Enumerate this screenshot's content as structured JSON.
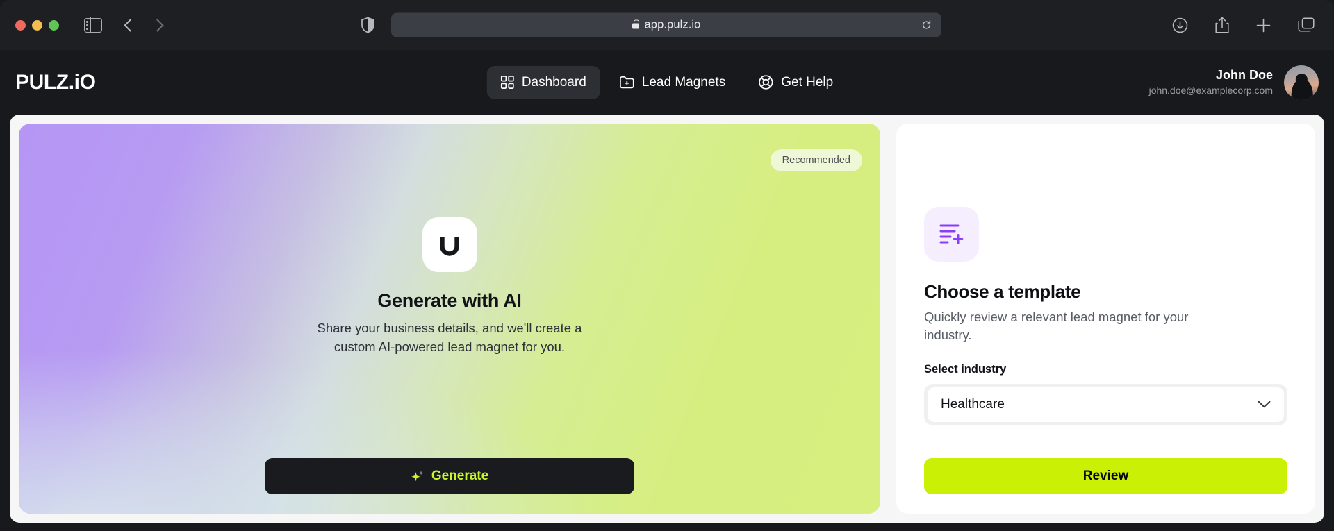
{
  "browser": {
    "traffic_lights": [
      "close",
      "minimize",
      "maximize"
    ],
    "url": "app.pulz.io",
    "secure": true,
    "back_icon": "chevron-left-icon",
    "forward_icon": "chevron-right-icon",
    "sidebar_icon": "sidebar-toggle-icon",
    "shield_icon": "shield-privacy-icon",
    "reload_icon": "reload-icon",
    "right_icons": [
      "downloads-icon",
      "share-icon",
      "new-tab-icon",
      "tab-overview-icon"
    ]
  },
  "header": {
    "brand": "PULZ.iO",
    "nav": [
      {
        "label": "Dashboard",
        "icon": "grid-icon",
        "active": true
      },
      {
        "label": "Lead Magnets",
        "icon": "folder-plus-icon",
        "active": false
      },
      {
        "label": "Get Help",
        "icon": "lifebuoy-icon",
        "active": false
      }
    ],
    "user": {
      "name": "John Doe",
      "email": "john.doe@examplecorp.com",
      "avatar": "user-avatar"
    }
  },
  "generate_card": {
    "badge": "Recommended",
    "icon": "magnet-icon",
    "title": "Generate with AI",
    "subtitle": "Share your business details, and we'll create a custom AI-powered lead magnet for you.",
    "button_label": "Generate",
    "button_icon": "sparkle-icon",
    "gradient_start": "#b596f5",
    "gradient_end": "#d7ef7e",
    "button_bg": "#191b1f",
    "button_text_color": "#c9f62b"
  },
  "template_panel": {
    "icon": "template-lines-plus-icon",
    "title": "Choose a template",
    "subtitle": "Quickly review a relevant lead magnet for your industry.",
    "field_label": "Select industry",
    "select_value": "Healthcare",
    "select_icon": "chevron-down-icon",
    "button_label": "Review",
    "button_bg": "#c9f005",
    "icon_tile_bg": "#f4eefe",
    "icon_color": "#8b3dfa"
  }
}
